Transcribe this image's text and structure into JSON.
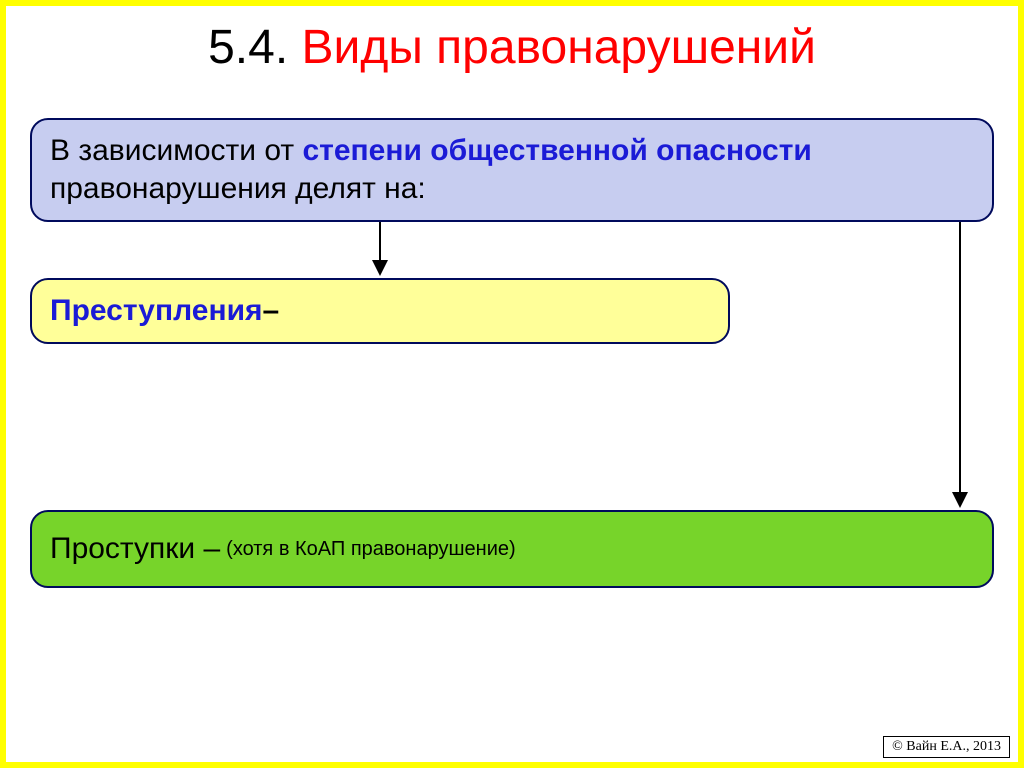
{
  "title": {
    "number": "5.4.",
    "text": "Виды правонарушений"
  },
  "top_box": {
    "part1": "В зависимости от ",
    "highlight": "степени общественной опасности",
    "part2": " правонарушения делят на:"
  },
  "mid_box": {
    "label": "Преступления",
    "dash": " – "
  },
  "bot_box": {
    "label": "Проступки – ",
    "note": "(хотя в КоАП правонарушение)"
  },
  "copyright": "© Вайн Е.А., 2013"
}
